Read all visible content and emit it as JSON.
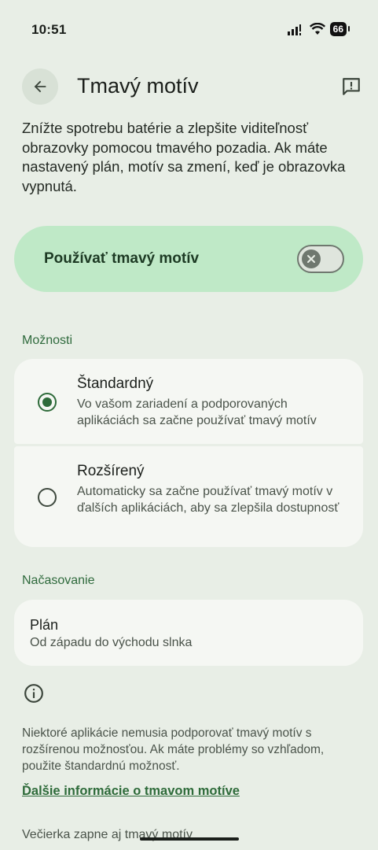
{
  "status_bar": {
    "time": "10:51",
    "battery": "66",
    "icons": [
      "signal-icon",
      "wifi-icon",
      "battery-icon"
    ]
  },
  "header": {
    "title": "Tmavý motív",
    "back_icon": "arrow-back-icon",
    "feedback_icon": "feedback-icon"
  },
  "description": "Znížte spotrebu batérie a zlepšite viditeľnosť obrazovky pomocou tmavého pozadia. Ak máte nastavený plán, motív sa zmení, keď je obrazovka vypnutá.",
  "main_switch": {
    "label": "Používať tmavý motív",
    "enabled": false
  },
  "options": {
    "header": "Možnosti",
    "items": [
      {
        "title": "Štandardný",
        "subtitle": "Vo vašom zariadení a podporovaných aplikáciách sa začne používať tmavý motív",
        "selected": true
      },
      {
        "title": "Rozšírený",
        "subtitle": "Automaticky sa začne používať tmavý motív v ďalších aplikáciách, aby sa zlepšila dostupnosť",
        "selected": false
      }
    ]
  },
  "schedule": {
    "header": "Načasovanie",
    "title": "Plán",
    "subtitle": "Od západu do východu slnka"
  },
  "footer": {
    "info_icon": "info-icon",
    "note": "Niektoré aplikácie nemusia podporovať tmavý motív s rozšírenou možnosťou. Ak máte problémy so vzhľadom, použite štandardnú možnosť.",
    "link": "Ďalšie informácie o tmavom motíve",
    "bedtime": "Večierka zapne aj tmavý motív"
  },
  "colors": {
    "background": "#e8eee6",
    "accent": "#2e6b3a",
    "switch_bg": "#bfe9c7",
    "card_bg": "#f5f7f3"
  }
}
